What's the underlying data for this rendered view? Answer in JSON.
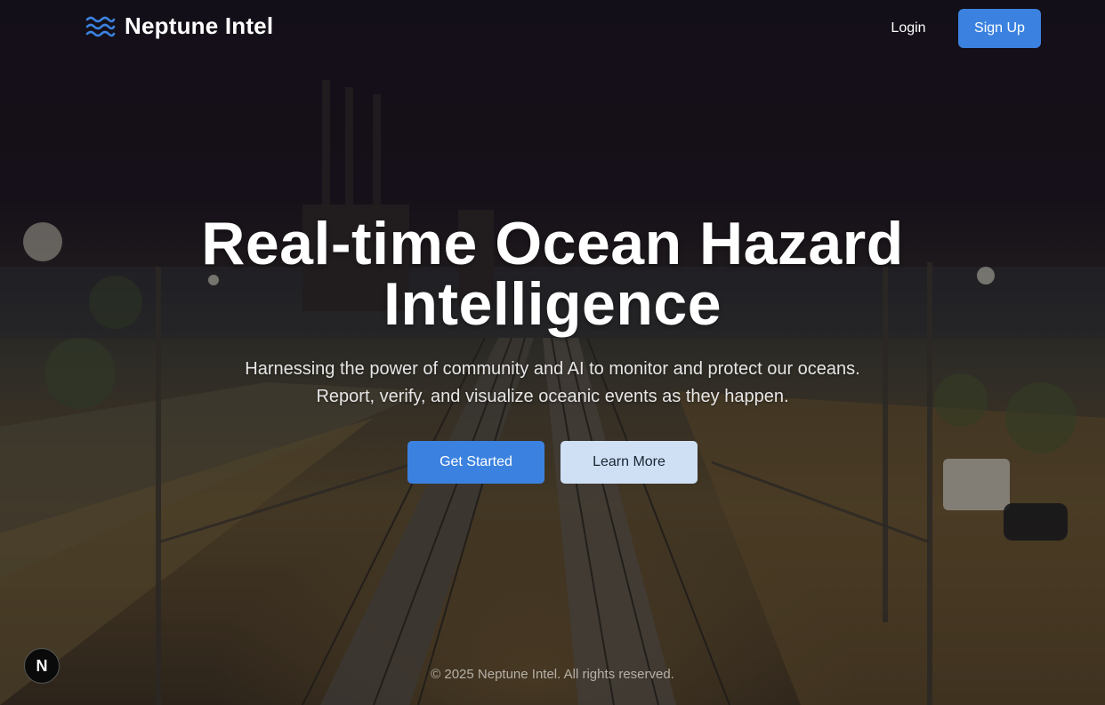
{
  "header": {
    "brand_name": "Neptune Intel",
    "brand_icon": "waves-icon",
    "login_label": "Login",
    "signup_label": "Sign Up"
  },
  "hero": {
    "title": "Real-time Ocean Hazard Intelligence",
    "subtitle_line1": "Harnessing the power of community and AI to monitor and protect our oceans.",
    "subtitle_line2": "Report, verify, and visualize oceanic events as they happen.",
    "primary_cta": "Get Started",
    "secondary_cta": "Learn More"
  },
  "footer": {
    "copyright": "© 2025 Neptune Intel. All rights reserved."
  },
  "dev_badge": {
    "label": "N",
    "icon": "nextjs-icon"
  },
  "colors": {
    "accent": "#3b82e0",
    "secondary_button": "#cfe0f5",
    "text": "#ffffff"
  }
}
